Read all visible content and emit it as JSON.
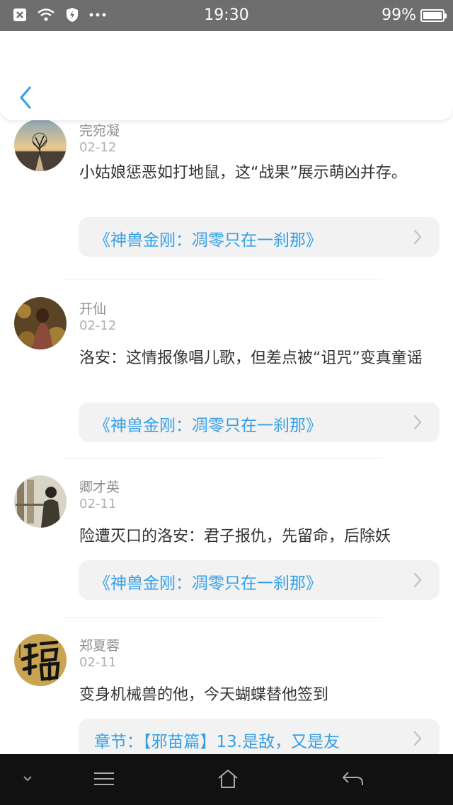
{
  "status_bar": {
    "time": "19:30",
    "battery": "99%",
    "battery_level": 0.99,
    "icons": [
      "close-box-icon",
      "wifi-icon",
      "shield-icon",
      "more-dots-icon"
    ]
  },
  "header": {
    "back_icon": "chevron-left-icon"
  },
  "feed": [
    {
      "name": "完宛凝",
      "date": "02-12",
      "content": "小姑娘惩恶如打地鼠，这“战果”展示萌凶并存。",
      "link": "《神兽金刚：凋零只在一刹那》"
    },
    {
      "name": "开仙",
      "date": "02-12",
      "content": "洛安：这情报像唱儿歌，但差点被“诅咒”变真童谣",
      "link": "《神兽金刚：凋零只在一刹那》"
    },
    {
      "name": "卿才英",
      "date": "02-11",
      "content": "险遭灭口的洛安：君子报仇，先留命，后除妖",
      "link": "《神兽金刚：凋零只在一刹那》"
    },
    {
      "name": "郑夏蓉",
      "date": "02-11",
      "content": "变身机械兽的他，今天蝴蝶替他签到",
      "link": "章节：【邪苗篇】13.是敌，又是友"
    }
  ],
  "colors": {
    "accent": "#35a0e6",
    "status_bar": "#6e6e6e",
    "nav_bar": "#111111"
  }
}
